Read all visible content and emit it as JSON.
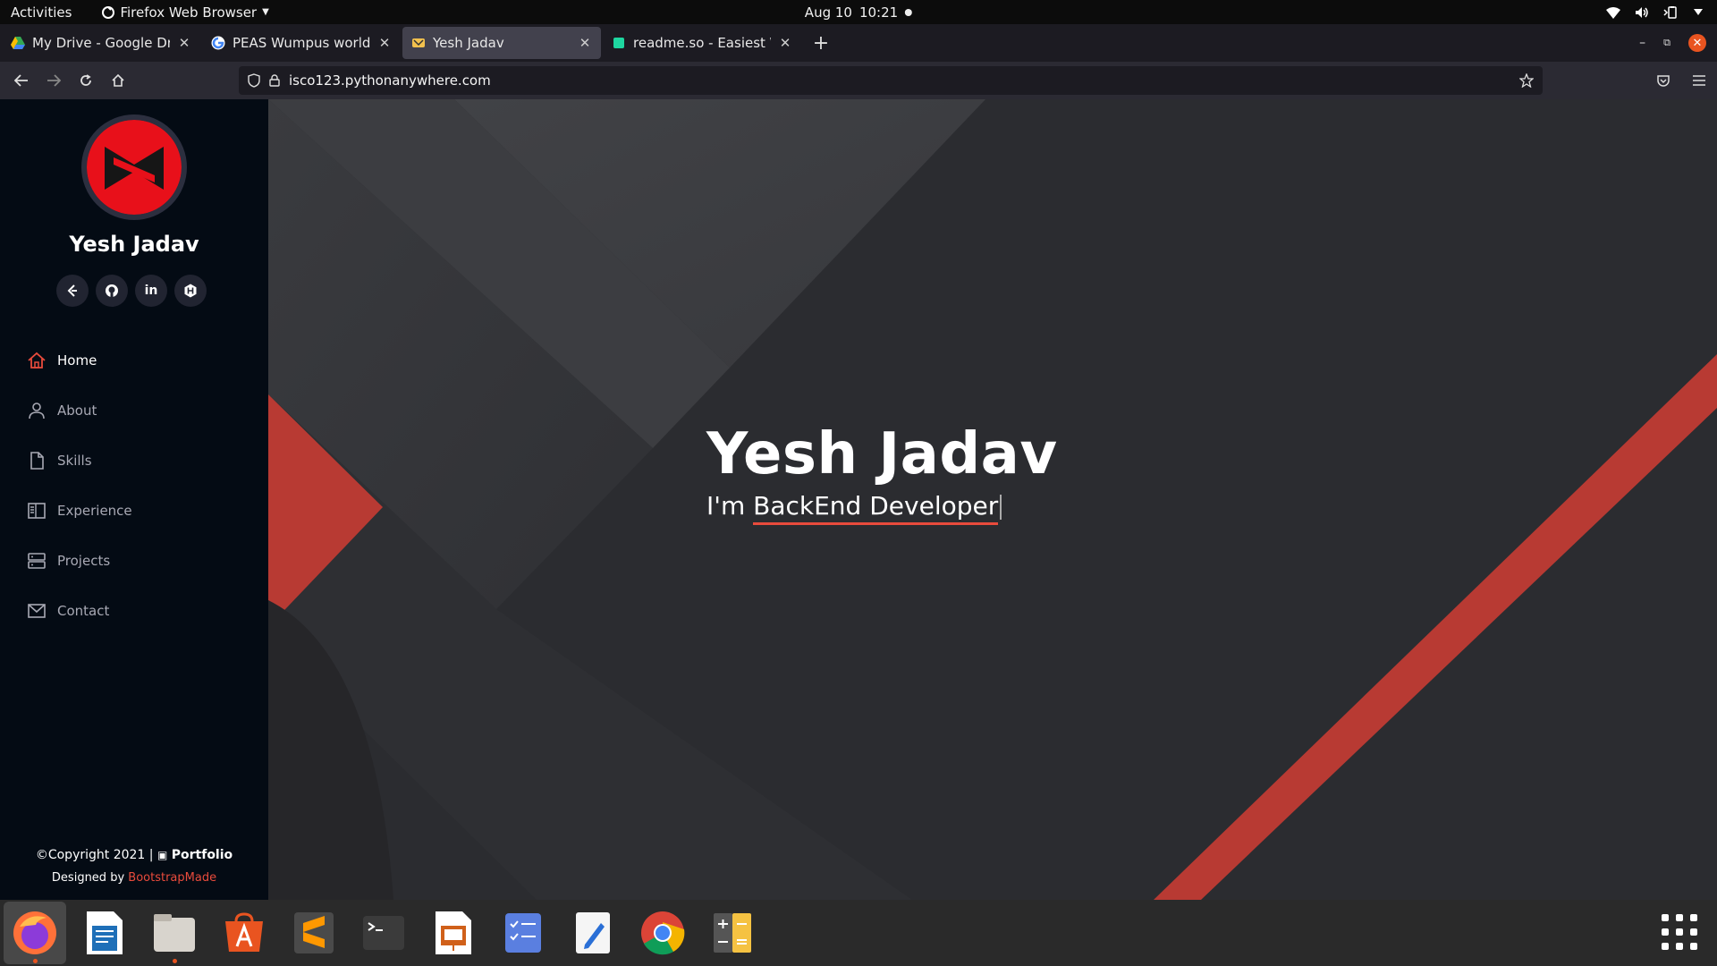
{
  "topbar": {
    "activities": "Activities",
    "app_name": "Firefox Web Browser",
    "date": "Aug 10",
    "time": "10:21"
  },
  "tabs": [
    {
      "title": "My Drive - Google Drive",
      "icon": "google-drive-icon",
      "active": false
    },
    {
      "title": "PEAS Wumpus world Sen",
      "icon": "google-icon",
      "active": false
    },
    {
      "title": "Yesh Jadav",
      "icon": "site-favicon-icon",
      "active": true
    },
    {
      "title": "readme.so - Easiest Way t",
      "icon": "readme-icon",
      "active": false
    }
  ],
  "urlbar": {
    "url": "isco123.pythonanywhere.com"
  },
  "sidebar": {
    "name": "Yesh Jadav",
    "social": [
      "leetcode-icon",
      "github-icon",
      "linkedin-icon",
      "hackerrank-icon"
    ],
    "menu": [
      {
        "label": "Home",
        "icon": "home-icon",
        "active": true
      },
      {
        "label": "About",
        "icon": "person-icon",
        "active": false
      },
      {
        "label": "Skills",
        "icon": "file-icon",
        "active": false
      },
      {
        "label": "Experience",
        "icon": "book-icon",
        "active": false
      },
      {
        "label": "Projects",
        "icon": "server-icon",
        "active": false
      },
      {
        "label": "Contact",
        "icon": "envelope-icon",
        "active": false
      }
    ],
    "footer": {
      "copyright_symbol": "©",
      "copyright": "Copyright 2021 | ",
      "brand": "Portfolio",
      "designed_by": "Designed by ",
      "designer": "BootstrapMade"
    }
  },
  "hero": {
    "title": "Yesh Jadav",
    "prefix": "I'm ",
    "typed": "BackEnd Developer"
  },
  "dock": [
    "firefox-icon",
    "writer-icon",
    "files-icon",
    "software-center-icon",
    "sublime-text-icon",
    "terminal-icon",
    "impress-icon",
    "tasks-icon",
    "text-editor-icon",
    "chrome-icon",
    "calculator-icon"
  ],
  "colors": {
    "accent": "#e94b3c",
    "sidebar_bg": "#040b14",
    "hero_bg": "#2b2c30",
    "ubuntu_orange": "#e95420"
  }
}
